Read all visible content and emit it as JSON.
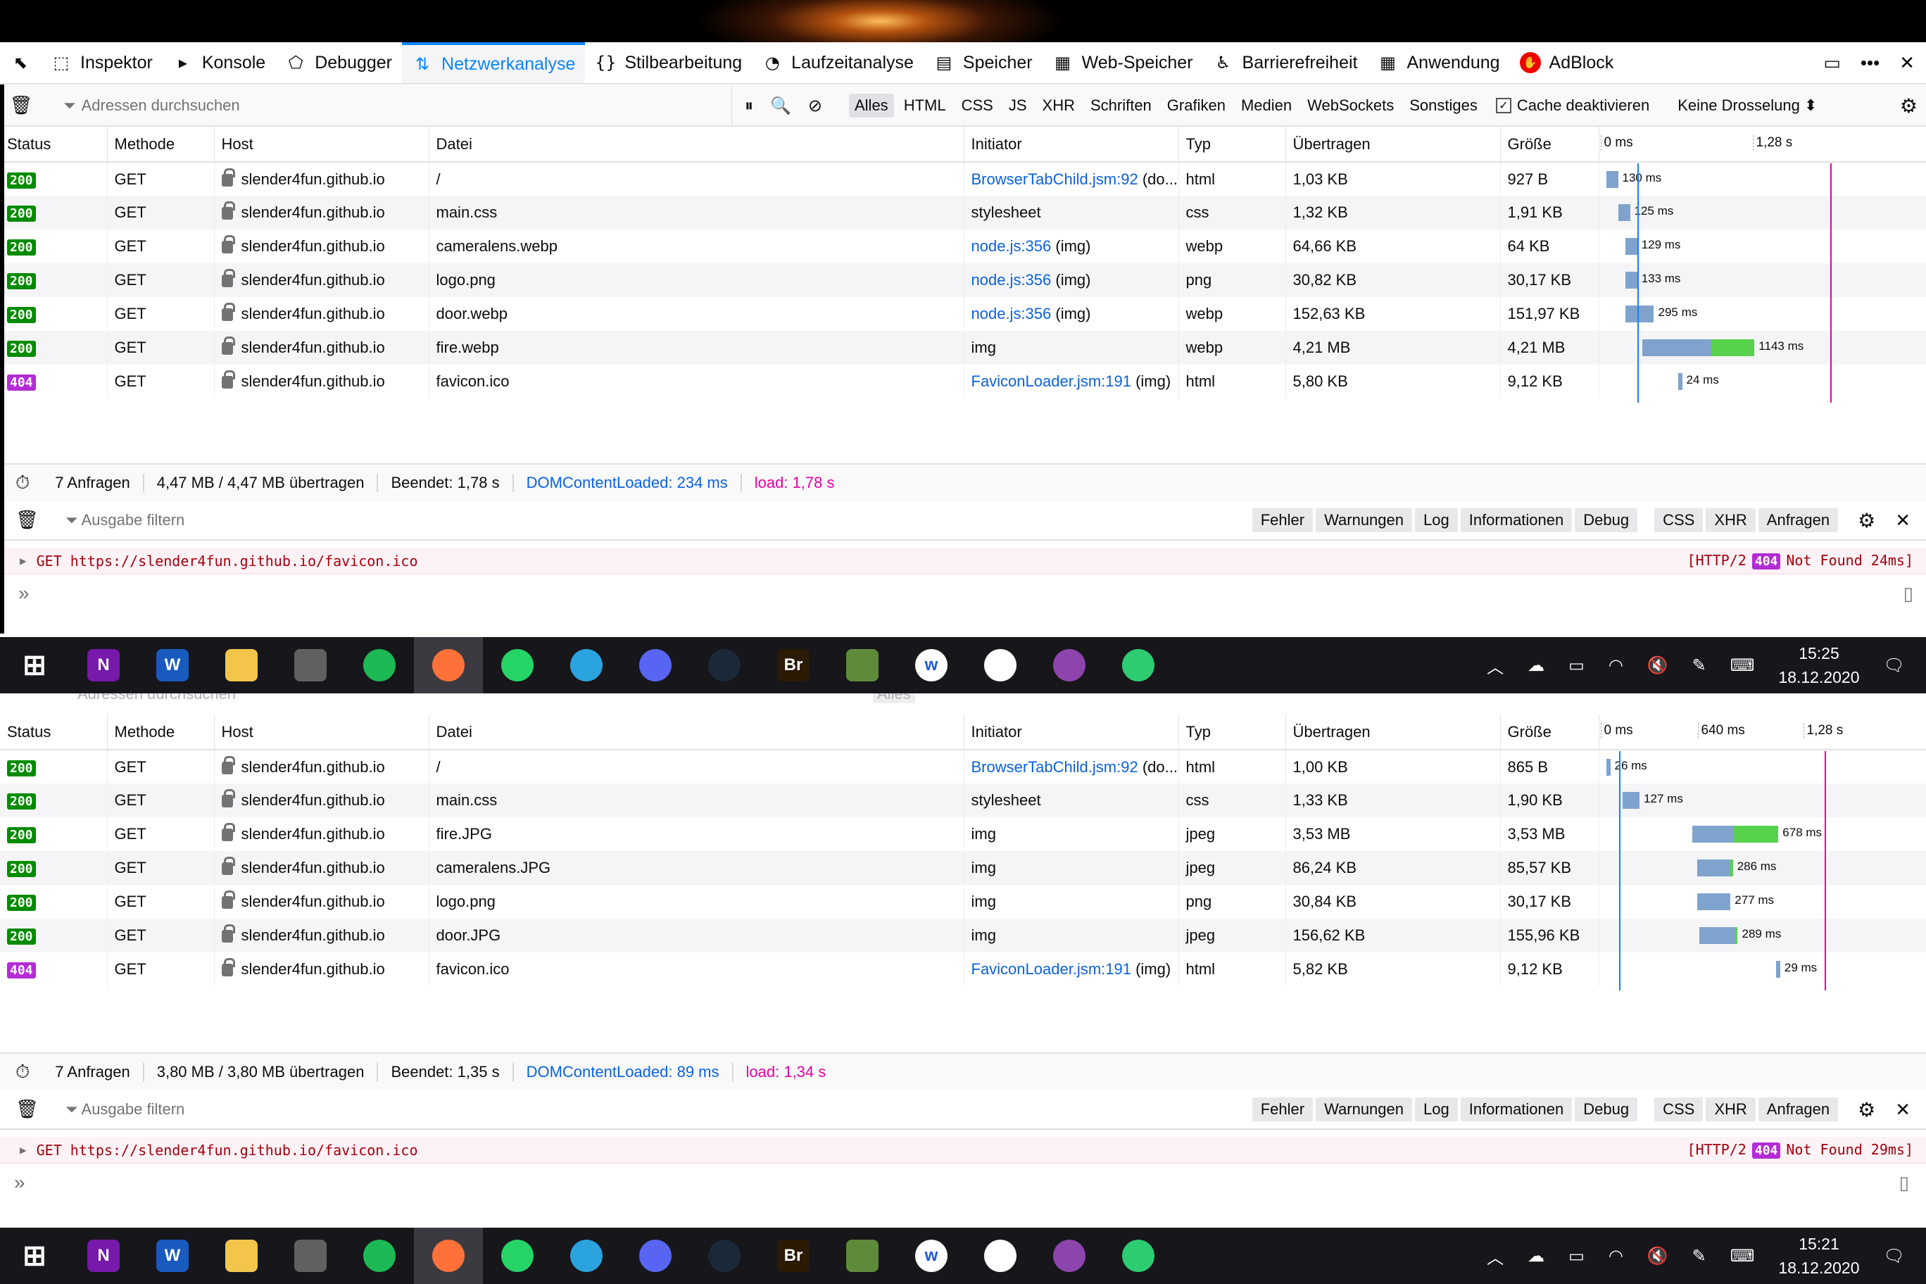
{
  "toolbar": {
    "tabs": [
      {
        "label": "Inspektor",
        "icon": "inspector-icon"
      },
      {
        "label": "Konsole",
        "icon": "console-icon"
      },
      {
        "label": "Debugger",
        "icon": "debugger-icon"
      },
      {
        "label": "Netzwerkanalyse",
        "icon": "network-icon",
        "active": true
      },
      {
        "label": "Stilbearbeitung",
        "icon": "style-editor-icon"
      },
      {
        "label": "Laufzeitanalyse",
        "icon": "performance-icon"
      },
      {
        "label": "Speicher",
        "icon": "memory-icon"
      },
      {
        "label": "Web-Speicher",
        "icon": "storage-icon"
      },
      {
        "label": "Barrierefreiheit",
        "icon": "accessibility-icon"
      },
      {
        "label": "Anwendung",
        "icon": "application-icon"
      },
      {
        "label": "AdBlock",
        "icon": "adblock-icon"
      }
    ]
  },
  "netfilter": {
    "placeholder": "Adressen durchsuchen",
    "types": [
      "Alles",
      "HTML",
      "CSS",
      "JS",
      "XHR",
      "Schriften",
      "Grafiken",
      "Medien",
      "WebSockets",
      "Sonstiges"
    ],
    "cache_label": "Cache deaktivieren",
    "throttle": "Keine Drosselung ⬍"
  },
  "columns": [
    "Status",
    "Methode",
    "Host",
    "Datei",
    "Initiator",
    "Typ",
    "Übertragen",
    "Größe"
  ],
  "panel1": {
    "timeline": {
      "t0": "0 ms",
      "t1": "1,28 s"
    },
    "rows": [
      {
        "status": "200",
        "method": "GET",
        "host": "slender4fun.github.io",
        "file": "/",
        "initiator": "BrowserTabChild.jsm:92",
        "initiator_suffix": " (do...",
        "link": true,
        "type": "html",
        "transferred": "1,03 KB",
        "size": "927 B",
        "ms": "130 ms",
        "start": 0.0,
        "wait": 0.05,
        "recv": 0.0
      },
      {
        "status": "200",
        "method": "GET",
        "host": "slender4fun.github.io",
        "file": "main.css",
        "initiator": "stylesheet",
        "initiator_suffix": "",
        "link": false,
        "type": "css",
        "transferred": "1,32 KB",
        "size": "1,91 KB",
        "ms": "125 ms",
        "start": 0.05,
        "wait": 0.05,
        "recv": 0.0
      },
      {
        "status": "200",
        "method": "GET",
        "host": "slender4fun.github.io",
        "file": "cameralens.webp",
        "initiator": "node.js:356",
        "initiator_suffix": " (img)",
        "link": true,
        "type": "webp",
        "transferred": "64,66 KB",
        "size": "64 KB",
        "ms": "129 ms",
        "start": 0.08,
        "wait": 0.05,
        "recv": 0.0
      },
      {
        "status": "200",
        "method": "GET",
        "host": "slender4fun.github.io",
        "file": "logo.png",
        "initiator": "node.js:356",
        "initiator_suffix": " (img)",
        "link": true,
        "type": "png",
        "transferred": "30,82 KB",
        "size": "30,17 KB",
        "ms": "133 ms",
        "start": 0.08,
        "wait": 0.05,
        "recv": 0.0
      },
      {
        "status": "200",
        "method": "GET",
        "host": "slender4fun.github.io",
        "file": "door.webp",
        "initiator": "node.js:356",
        "initiator_suffix": " (img)",
        "link": true,
        "type": "webp",
        "transferred": "152,63 KB",
        "size": "151,97 KB",
        "ms": "295 ms",
        "start": 0.08,
        "wait": 0.12,
        "recv": 0.0
      },
      {
        "status": "200",
        "method": "GET",
        "host": "slender4fun.github.io",
        "file": "fire.webp",
        "initiator": "img",
        "initiator_suffix": "",
        "link": false,
        "type": "webp",
        "transferred": "4,21 MB",
        "size": "4,21 MB",
        "ms": "1143 ms",
        "start": 0.15,
        "wait": 0.29,
        "recv": 0.18
      },
      {
        "status": "404",
        "method": "GET",
        "host": "slender4fun.github.io",
        "file": "favicon.ico",
        "initiator": "FaviconLoader.jsm:191",
        "initiator_suffix": " (img)",
        "link": true,
        "type": "html",
        "transferred": "5,80 KB",
        "size": "9,12 KB",
        "ms": "24 ms",
        "start": 0.3,
        "wait": 0.01,
        "recv": 0.0
      }
    ],
    "summary": {
      "requests": "7 Anfragen",
      "transferred": "4,47 MB / 4,47 MB übertragen",
      "finished": "Beendet: 1,78 s",
      "dcl": "DOMContentLoaded: 234 ms",
      "load": "load: 1,78 s"
    },
    "console": {
      "placeholder": "Ausgabe filtern",
      "message": "GET https://slender4fun.github.io/favicon.ico",
      "status_pre": "[HTTP/2",
      "status_code": "404",
      "status_post": "Not Found 24ms]"
    },
    "clock": {
      "time": "15:25",
      "date": "18.12.2020"
    }
  },
  "panel2": {
    "timeline": {
      "t0": "0 ms",
      "t1": "640 ms",
      "t2": "1,28 s"
    },
    "rows": [
      {
        "status": "200",
        "method": "GET",
        "host": "slender4fun.github.io",
        "file": "/",
        "initiator": "BrowserTabChild.jsm:92",
        "initiator_suffix": " (do...",
        "link": true,
        "type": "html",
        "transferred": "1,00 KB",
        "size": "865 B",
        "ms": "26 ms",
        "start": 0.0,
        "wait": 0.01,
        "recv": 0.0
      },
      {
        "status": "200",
        "method": "GET",
        "host": "slender4fun.github.io",
        "file": "main.css",
        "initiator": "stylesheet",
        "initiator_suffix": "",
        "link": false,
        "type": "css",
        "transferred": "1,33 KB",
        "size": "1,90 KB",
        "ms": "127 ms",
        "start": 0.07,
        "wait": 0.07,
        "recv": 0.0
      },
      {
        "status": "200",
        "method": "GET",
        "host": "slender4fun.github.io",
        "file": "fire.JPG",
        "initiator": "img",
        "initiator_suffix": "",
        "link": false,
        "type": "jpeg",
        "transferred": "3,53 MB",
        "size": "3,53 MB",
        "ms": "678 ms",
        "start": 0.36,
        "wait": 0.17,
        "recv": 0.19
      },
      {
        "status": "200",
        "method": "GET",
        "host": "slender4fun.github.io",
        "file": "cameralens.JPG",
        "initiator": "img",
        "initiator_suffix": "",
        "link": false,
        "type": "jpeg",
        "transferred": "86,24 KB",
        "size": "85,57 KB",
        "ms": "286 ms",
        "start": 0.38,
        "wait": 0.14,
        "recv": 0.01
      },
      {
        "status": "200",
        "method": "GET",
        "host": "slender4fun.github.io",
        "file": "logo.png",
        "initiator": "img",
        "initiator_suffix": "",
        "link": false,
        "type": "png",
        "transferred": "30,84 KB",
        "size": "30,17 KB",
        "ms": "277 ms",
        "start": 0.38,
        "wait": 0.14,
        "recv": 0.0
      },
      {
        "status": "200",
        "method": "GET",
        "host": "slender4fun.github.io",
        "file": "door.JPG",
        "initiator": "img",
        "initiator_suffix": "",
        "link": false,
        "type": "jpeg",
        "transferred": "156,62 KB",
        "size": "155,96 KB",
        "ms": "289 ms",
        "start": 0.39,
        "wait": 0.15,
        "recv": 0.01
      },
      {
        "status": "404",
        "method": "GET",
        "host": "slender4fun.github.io",
        "file": "favicon.ico",
        "initiator": "FaviconLoader.jsm:191",
        "initiator_suffix": " (img)",
        "link": true,
        "type": "html",
        "transferred": "5,82 KB",
        "size": "9,12 KB",
        "ms": "29 ms",
        "start": 0.71,
        "wait": 0.01,
        "recv": 0.0
      }
    ],
    "summary": {
      "requests": "7 Anfragen",
      "transferred": "3,80 MB / 3,80 MB übertragen",
      "finished": "Beendet: 1,35 s",
      "dcl": "DOMContentLoaded: 89 ms",
      "load": "load: 1,34 s"
    },
    "console": {
      "placeholder": "Ausgabe filtern",
      "message": "GET https://slender4fun.github.io/favicon.ico",
      "status_pre": "[HTTP/2",
      "status_code": "404",
      "status_post": "Not Found 29ms]"
    },
    "clock": {
      "time": "15:21",
      "date": "18.12.2020"
    }
  },
  "console_buttons": [
    "Fehler",
    "Warnungen",
    "Log",
    "Informationen",
    "Debug",
    "CSS",
    "XHR",
    "Anfragen"
  ],
  "taskbar_apps": [
    {
      "name": "windows-start-icon",
      "label": "",
      "color": "#16161b"
    },
    {
      "name": "onenote-icon",
      "label": "N",
      "color": "#7719aa"
    },
    {
      "name": "word-icon",
      "label": "W",
      "color": "#185abd"
    },
    {
      "name": "file-explorer-icon",
      "label": "",
      "color": "#f3c54a"
    },
    {
      "name": "calculator-icon",
      "label": "",
      "color": "#606060"
    },
    {
      "name": "spotify-icon",
      "label": "",
      "color": "#1db954"
    },
    {
      "name": "firefox-icon",
      "label": "",
      "color": "#ff7139"
    },
    {
      "name": "whatsapp-icon",
      "label": "",
      "color": "#25d366"
    },
    {
      "name": "telegram-icon",
      "label": "",
      "color": "#2aa3df"
    },
    {
      "name": "discord-icon",
      "label": "",
      "color": "#5865f2"
    },
    {
      "name": "steam-icon",
      "label": "",
      "color": "#1b2838"
    },
    {
      "name": "bridge-icon",
      "label": "Br",
      "color": "#2b1a04"
    },
    {
      "name": "minecraft-icon",
      "label": "",
      "color": "#5f8a3a"
    },
    {
      "name": "webex-icon",
      "label": "w",
      "color": "#ffffff"
    },
    {
      "name": "oculus-icon",
      "label": "",
      "color": "#ffffff"
    },
    {
      "name": "github-desktop-icon",
      "label": "",
      "color": "#8e44ad"
    },
    {
      "name": "atom-icon",
      "label": "",
      "color": "#2ecc71"
    },
    {
      "name": "gimp-icon",
      "label": "",
      "color": "#16161b"
    }
  ]
}
